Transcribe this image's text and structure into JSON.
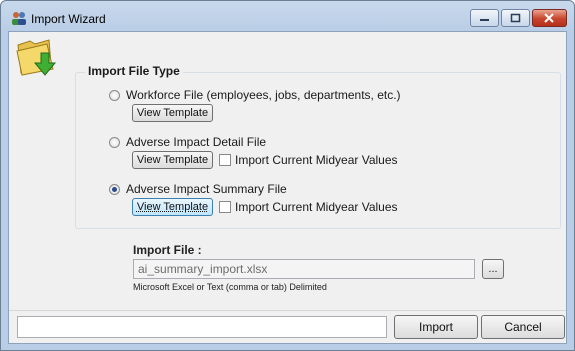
{
  "window": {
    "title": "Import Wizard"
  },
  "group": {
    "title": "Import File Type",
    "options": [
      {
        "label": "Workforce File (employees, jobs, departments, etc.)",
        "selected": false,
        "button": "View Template"
      },
      {
        "label": "Adverse Impact Detail File",
        "selected": false,
        "button": "View Template",
        "checkbox": "Import Current Midyear Values",
        "checked": false
      },
      {
        "label": "Adverse Impact Summary File",
        "selected": true,
        "button": "View Template",
        "checkbox": "Import Current Midyear Values",
        "checked": false
      }
    ]
  },
  "import_file": {
    "label": "Import File :",
    "value": "ai_summary_import.xlsx",
    "browse": "...",
    "hint": "Microsoft Excel or Text (comma or tab) Delimited"
  },
  "footer": {
    "status": "",
    "import_label": "Import",
    "cancel_label": "Cancel"
  },
  "icons": {
    "app": "people-icon",
    "folder": "folder-download-icon"
  }
}
